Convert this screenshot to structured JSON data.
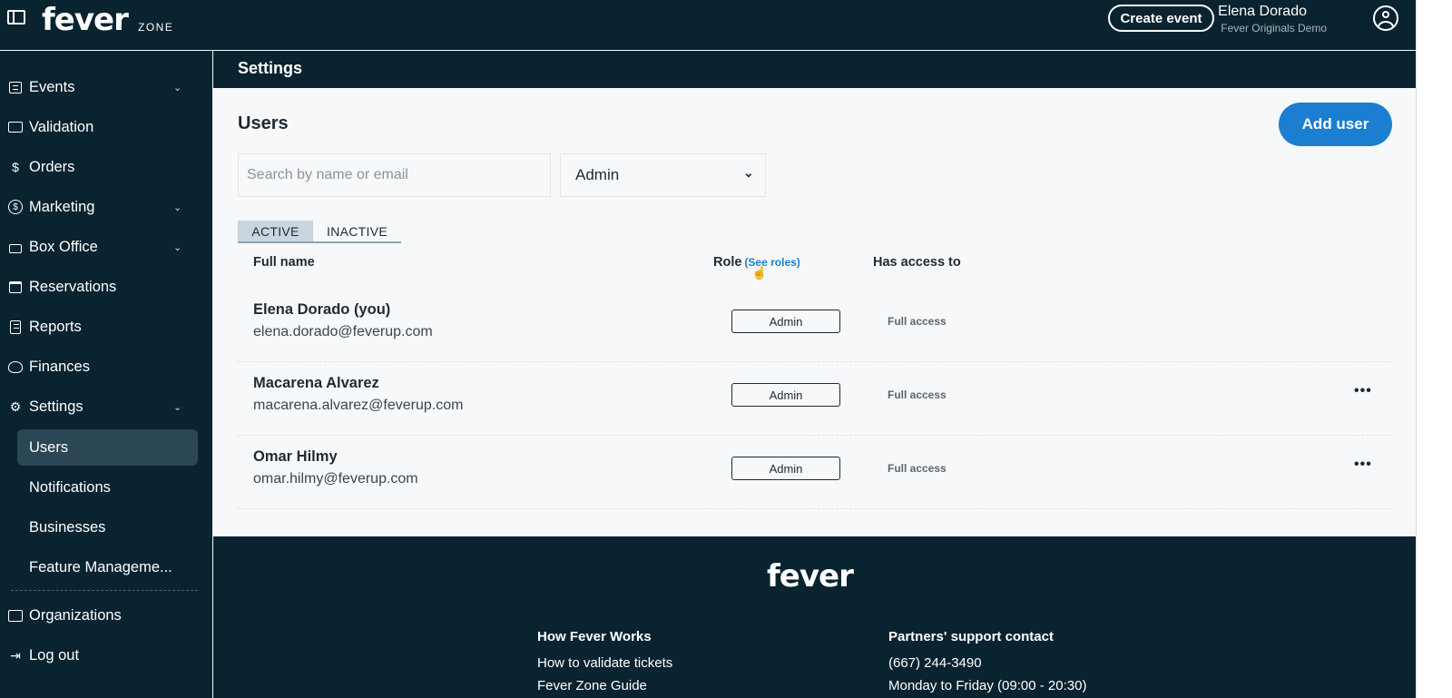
{
  "topbar": {
    "logo": "fever",
    "logo_suffix": "ZONE",
    "create_event": "Create event",
    "user_name": "Elena Dorado",
    "user_org": "Fever Originals Demo"
  },
  "sidebar": {
    "items": [
      {
        "label": "Events",
        "icon": "list-icon",
        "has_chevron": true
      },
      {
        "label": "Validation",
        "icon": "ticket-icon"
      },
      {
        "label": "Orders",
        "icon": "dollar-icon"
      },
      {
        "label": "Marketing",
        "icon": "coin-icon",
        "has_chevron": true
      },
      {
        "label": "Box Office",
        "icon": "register-icon",
        "has_chevron": true
      },
      {
        "label": "Reservations",
        "icon": "calendar-icon"
      },
      {
        "label": "Reports",
        "icon": "document-icon"
      },
      {
        "label": "Finances",
        "icon": "piggy-bank-icon"
      },
      {
        "label": "Settings",
        "icon": "gear-icon",
        "has_chevron": true
      }
    ],
    "settings_sub": [
      {
        "label": "Users",
        "active": true
      },
      {
        "label": "Notifications"
      },
      {
        "label": "Businesses"
      },
      {
        "label": "Feature Manageme..."
      }
    ],
    "bottom": [
      {
        "label": "Organizations",
        "icon": "buildings-icon"
      },
      {
        "label": "Log out",
        "icon": "logout-icon"
      }
    ]
  },
  "header": {
    "title": "Settings"
  },
  "main": {
    "title": "Users",
    "add_user": "Add user",
    "search_placeholder": "Search by name or email",
    "role_filter": "Admin",
    "tabs": [
      {
        "label": "ACTIVE",
        "active": true
      },
      {
        "label": "INACTIVE"
      }
    ],
    "columns": {
      "name": "Full name",
      "role": "Role",
      "see_roles": "(See roles)",
      "access": "Has access to"
    },
    "users": [
      {
        "name": "Elena Dorado (you)",
        "email": "elena.dorado@feverup.com",
        "role": "Admin",
        "access": "Full access",
        "more": ""
      },
      {
        "name": "Macarena Alvarez",
        "email": "macarena.alvarez@feverup.com",
        "role": "Admin",
        "access": "Full access",
        "more": "•••"
      },
      {
        "name": "Omar Hilmy",
        "email": "omar.hilmy@feverup.com",
        "role": "Admin",
        "access": "Full access",
        "more": "•••"
      }
    ]
  },
  "footer": {
    "logo": "fever",
    "col1_head": "How Fever Works",
    "col1_links": [
      "How to validate tickets",
      "Fever Zone Guide"
    ],
    "col2_head": "Partners' support contact",
    "col2_links": [
      "(667) 244-3490",
      "Monday to Friday (09:00 - 20:30)"
    ]
  },
  "colors": {
    "navy": "#0a2330",
    "accent": "#1b7ed0"
  }
}
